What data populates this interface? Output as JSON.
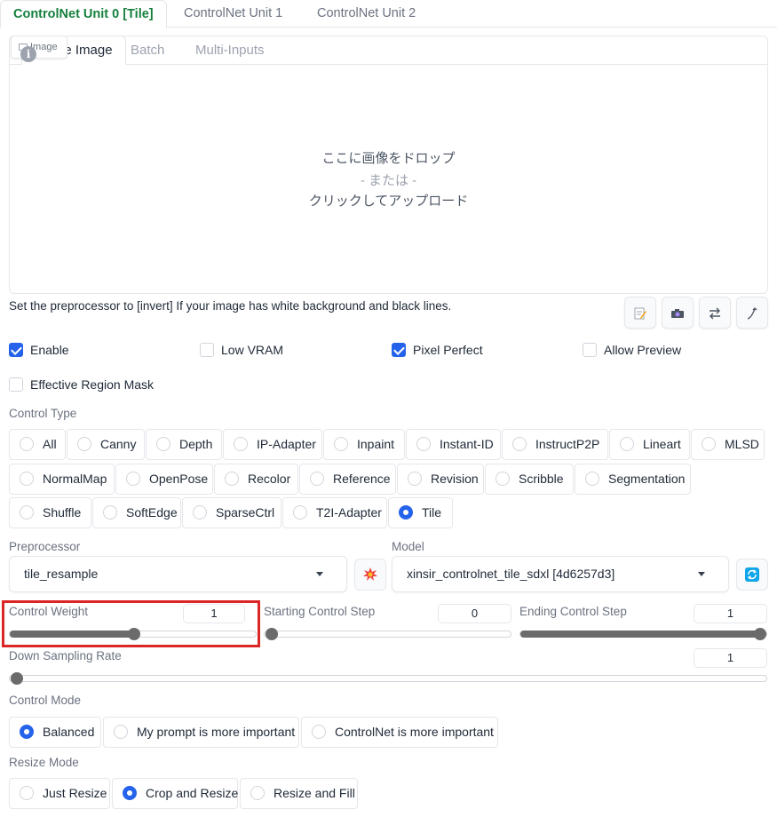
{
  "unit_tabs": [
    "ControlNet Unit 0 [Tile]",
    "ControlNet Unit 1",
    "ControlNet Unit 2"
  ],
  "image_tabs": [
    "Single Image",
    "Batch",
    "Multi-Inputs"
  ],
  "image_label": "Image",
  "drop": {
    "line1": "ここに画像をドロップ",
    "line2": "- または -",
    "line3": "クリックしてアップロード"
  },
  "hint": "Set the preprocessor to [invert] If your image has white background and black lines.",
  "tools": [
    "edit-icon",
    "camera-icon",
    "swap-icon",
    "curve-arrow-icon"
  ],
  "checkboxes": {
    "enable": {
      "label": "Enable",
      "checked": true
    },
    "low_vram": {
      "label": "Low VRAM",
      "checked": false
    },
    "pixel_perfect": {
      "label": "Pixel Perfect",
      "checked": true
    },
    "allow_preview": {
      "label": "Allow Preview",
      "checked": false
    },
    "effective_region_mask": {
      "label": "Effective Region Mask",
      "checked": false
    }
  },
  "control_type": {
    "label": "Control Type",
    "options": [
      "All",
      "Canny",
      "Depth",
      "IP-Adapter",
      "Inpaint",
      "Instant-ID",
      "InstructP2P",
      "Lineart",
      "MLSD",
      "NormalMap",
      "OpenPose",
      "Recolor",
      "Reference",
      "Revision",
      "Scribble",
      "Segmentation",
      "Shuffle",
      "SoftEdge",
      "SparseCtrl",
      "T2I-Adapter",
      "Tile"
    ],
    "selected": "Tile"
  },
  "preprocessor": {
    "label": "Preprocessor",
    "value": "tile_resample",
    "run_icon": "explosion-icon"
  },
  "model": {
    "label": "Model",
    "value": "xinsir_controlnet_tile_sdxl [4d6257d3]",
    "refresh_icon": "refresh-icon"
  },
  "sliders": {
    "control_weight": {
      "label": "Control Weight",
      "value": "1",
      "fraction": 0.5
    },
    "starting_step": {
      "label": "Starting Control Step",
      "value": "0",
      "fraction": 0
    },
    "ending_step": {
      "label": "Ending Control Step",
      "value": "1",
      "fraction": 1
    },
    "down_sampling": {
      "label": "Down Sampling Rate",
      "value": "1",
      "fraction": 0
    }
  },
  "control_mode": {
    "label": "Control Mode",
    "options": [
      "Balanced",
      "My prompt is more important",
      "ControlNet is more important"
    ],
    "selected": "Balanced"
  },
  "resize_mode": {
    "label": "Resize Mode",
    "options": [
      "Just Resize",
      "Crop and Resize",
      "Resize and Fill"
    ],
    "selected": "Crop and Resize"
  },
  "colors": {
    "accent_green": "#15803d",
    "accent_blue": "#2563eb",
    "highlight_red": "#dc2626"
  }
}
